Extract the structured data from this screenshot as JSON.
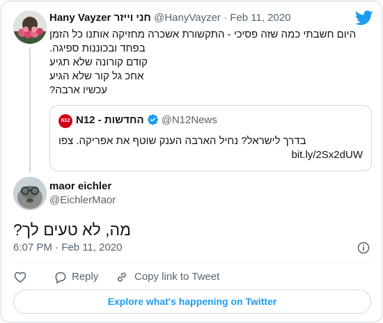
{
  "parent_tweet": {
    "display_name": "Hany Vayzer חני וייזר",
    "handle": "@HanyVayzer",
    "separator": "·",
    "date": "Feb 11, 2020",
    "text_lines": [
      "היום חשבתי כמה שזה פסיכי - התקשורת אשכרה מחזיקה אותנו כל הזמן בפחד ובכוננות ספיגה.",
      "קודם קורונה שלא תגיע",
      "אחכ גל קור שלא הגיע",
      "עכשיו ארבה?"
    ]
  },
  "quoted_tweet": {
    "avatar_label": "N12",
    "display_name": "N12 - החדשות",
    "handle": "@N12News",
    "text": "בדרך לישראל? נחיל הארבה הענק שוטף את אפריקה. צפו",
    "link": "bit.ly/2Sx2dUW"
  },
  "reply_tweet": {
    "display_name": "maor eichler",
    "handle": "@EichlerMaor",
    "text": "מה, לא טעים לך?",
    "time": "6:07 PM · Feb 11, 2020"
  },
  "actions": {
    "reply_label": "Reply",
    "copy_link_label": "Copy link to Tweet"
  },
  "explore_label": "Explore what's happening on Twitter",
  "colors": {
    "twitter_blue": "#1d9bf0",
    "text": "#0f1419",
    "muted": "#536471",
    "border": "#cfd9de",
    "n12_red": "#d0021b"
  },
  "icons": {
    "brand": "twitter-bird-icon",
    "verified": "verified-badge-icon",
    "info": "info-icon",
    "like": "heart-icon",
    "reply": "reply-bubble-icon",
    "copy": "link-icon"
  }
}
